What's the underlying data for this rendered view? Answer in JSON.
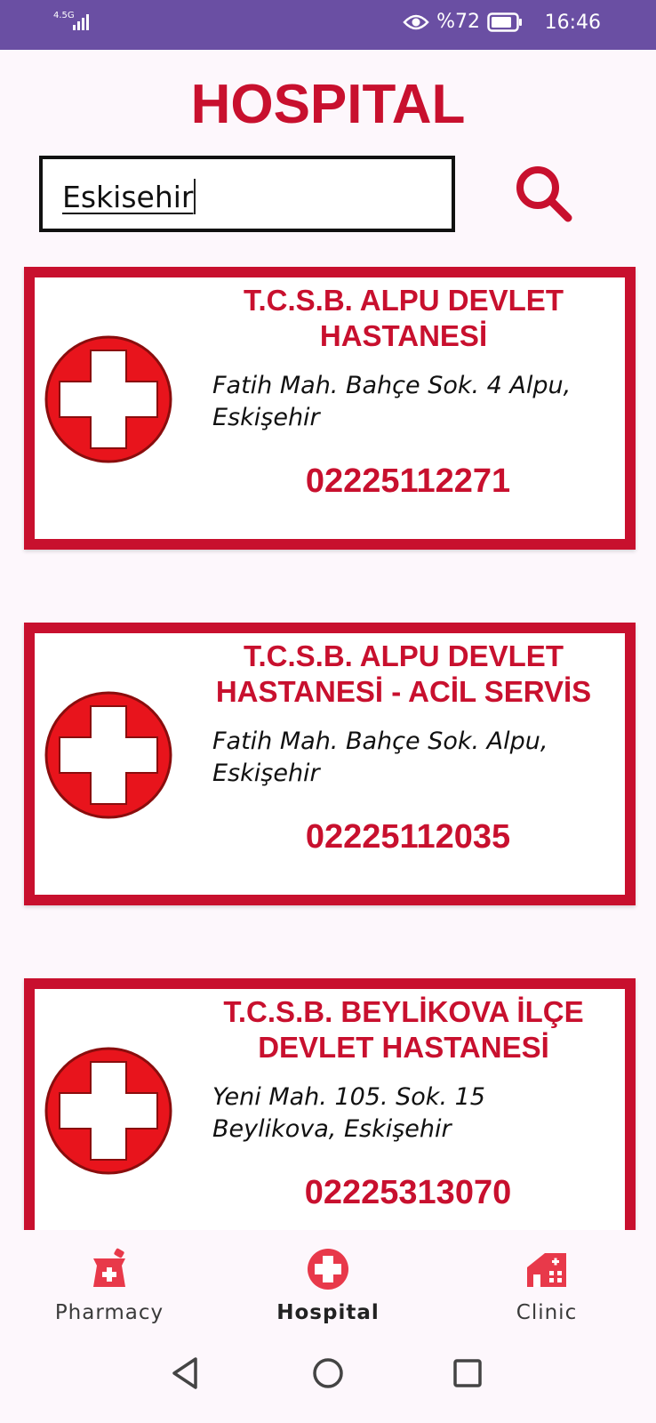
{
  "status_bar": {
    "network": "4.5G",
    "battery": "%72",
    "time": "16:46"
  },
  "header": {
    "title": "HOSPITAL"
  },
  "search": {
    "value": "Eskisehir"
  },
  "hospitals": [
    {
      "name": "T.C.S.B. ALPU DEVLET HASTANESİ",
      "address": "Fatih Mah. Bahçe Sok. 4 Alpu, Eskişehir",
      "phone": "02225112271"
    },
    {
      "name": "T.C.S.B. ALPU DEVLET HASTANESİ - ACİL SERVİS",
      "address": "Fatih Mah. Bahçe Sok. Alpu, Eskişehir",
      "phone": "02225112035"
    },
    {
      "name": "T.C.S.B. BEYLİKOVA İLÇE DEVLET HASTANESİ",
      "address": "Yeni Mah. 105. Sok. 15 Beylikova, Eskişehir",
      "phone": "02225313070"
    }
  ],
  "bottom_nav": {
    "items": [
      {
        "label": "Pharmacy",
        "icon": "pharmacy-icon",
        "active": false
      },
      {
        "label": "Hospital",
        "icon": "hospital-cross-icon",
        "active": true
      },
      {
        "label": "Clinic",
        "icon": "clinic-icon",
        "active": false
      }
    ]
  },
  "colors": {
    "accent": "#c8102e",
    "status_bar": "#6a4fa3",
    "background": "#fdf7fc"
  }
}
